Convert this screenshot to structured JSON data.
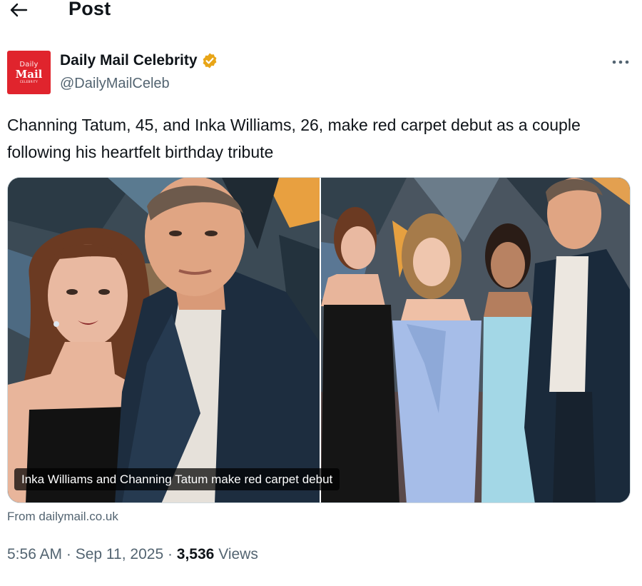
{
  "header": {
    "title": "Post"
  },
  "author": {
    "display_name": "Daily Mail Celebrity",
    "handle": "@DailyMailCeleb",
    "avatar": {
      "line1": "Daily",
      "line2": "Mail",
      "line3": "CELEBRITY",
      "bg_color": "#e0242d"
    },
    "verified_badge_color": "#e8a517"
  },
  "tweet": {
    "text": "Channing Tatum, 45, and Inka Williams, 26, make red carpet debut as a couple following his heartfelt birthday tribute"
  },
  "media": {
    "caption": "Inka Williams and Channing Tatum make red carpet debut",
    "source": "From dailymail.co.uk"
  },
  "meta": {
    "time": "5:56 AM",
    "sep1": " · ",
    "date": "Sep 11, 2025",
    "sep2": " · ",
    "views_count": "3,536",
    "views_label": " Views"
  },
  "icons": {
    "back": "arrow-left-icon",
    "more": "ellipsis-icon",
    "verified": "verified-badge-icon"
  }
}
